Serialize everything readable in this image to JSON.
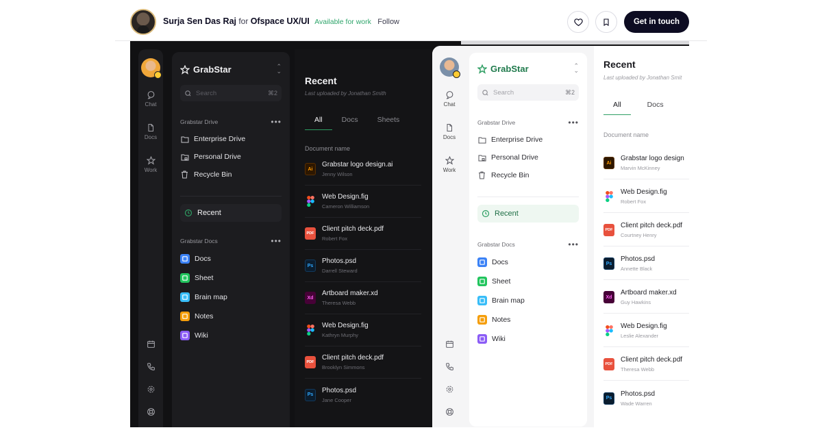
{
  "header": {
    "author": "Surja Sen Das Raj",
    "for": "for",
    "team": "Ofspace UX/UI",
    "available": "Available for work",
    "follow": "Follow",
    "cta": "Get in touch"
  },
  "app": {
    "brand": "GrabStar",
    "search_placeholder": "Search",
    "search_kbd": "⌘2",
    "rail": [
      {
        "label": "Chat",
        "icon": "chat-icon"
      },
      {
        "label": "Docs",
        "icon": "docs-icon"
      },
      {
        "label": "Work",
        "icon": "star-icon"
      }
    ],
    "drive_section": "Grabstar Drive",
    "drive_items": [
      {
        "label": "Enterprise Drive",
        "icon": "folder-icon"
      },
      {
        "label": "Personal Drive",
        "icon": "folder-lock-icon"
      },
      {
        "label": "Recycle Bin",
        "icon": "trash-icon"
      }
    ],
    "recent_label": "Recent",
    "docs_section": "Grabstar Docs",
    "docs_items": [
      {
        "label": "Docs",
        "color": "#3b82f6"
      },
      {
        "label": "Sheet",
        "color": "#22c55e"
      },
      {
        "label": "Brain map",
        "color": "#38bdf8"
      },
      {
        "label": "Notes",
        "color": "#f59e0b"
      },
      {
        "label": "Wiki",
        "color": "#8b5cf6"
      }
    ]
  },
  "main": {
    "title": "Recent",
    "subtitle_dark": "Last uploaded by Jonathan Smith",
    "subtitle_light": "Last uploaded by Jonathan Smit",
    "tabs": [
      "All",
      "Docs",
      "Sheets"
    ],
    "column": "Document name",
    "dark_files": [
      {
        "name": "Grabstar logo design.ai",
        "by": "Jenny Wilson",
        "type": "ai"
      },
      {
        "name": "Web Design.fig",
        "by": "Cameron Williamson",
        "type": "fig"
      },
      {
        "name": "Client pitch deck.pdf",
        "by": "Robert Fox",
        "type": "pdf"
      },
      {
        "name": "Photos.psd",
        "by": "Darrell Steward",
        "type": "ps"
      },
      {
        "name": "Artboard maker.xd",
        "by": "Theresa Webb",
        "type": "xd"
      },
      {
        "name": "Web Design.fig",
        "by": "Kathryn Murphy",
        "type": "fig"
      },
      {
        "name": "Client pitch deck.pdf",
        "by": "Brooklyn Simmons",
        "type": "pdf"
      },
      {
        "name": "Photos.psd",
        "by": "Jane Cooper",
        "type": "ps"
      }
    ],
    "light_files": [
      {
        "name": "Grabstar logo design",
        "by": "Marvin McKinney",
        "type": "ai"
      },
      {
        "name": "Web Design.fig",
        "by": "Robert Fox",
        "type": "fig"
      },
      {
        "name": "Client pitch deck.pdf",
        "by": "Courtney Henry",
        "type": "pdf"
      },
      {
        "name": "Photos.psd",
        "by": "Annette Black",
        "type": "ps"
      },
      {
        "name": "Artboard maker.xd",
        "by": "Guy Hawkins",
        "type": "xd"
      },
      {
        "name": "Web Design.fig",
        "by": "Leslie Alexander",
        "type": "fig"
      },
      {
        "name": "Client pitch deck.pdf",
        "by": "Theresa Webb",
        "type": "pdf"
      },
      {
        "name": "Photos.psd",
        "by": "Wade Warren",
        "type": "ps"
      }
    ],
    "file_badges": {
      "ai": "Ai",
      "pdf": "PDF",
      "ps": "Ps",
      "xd": "Xd",
      "fig": ""
    }
  },
  "colors": {
    "accent": "#2e9e63",
    "available": "#2fa56b"
  }
}
